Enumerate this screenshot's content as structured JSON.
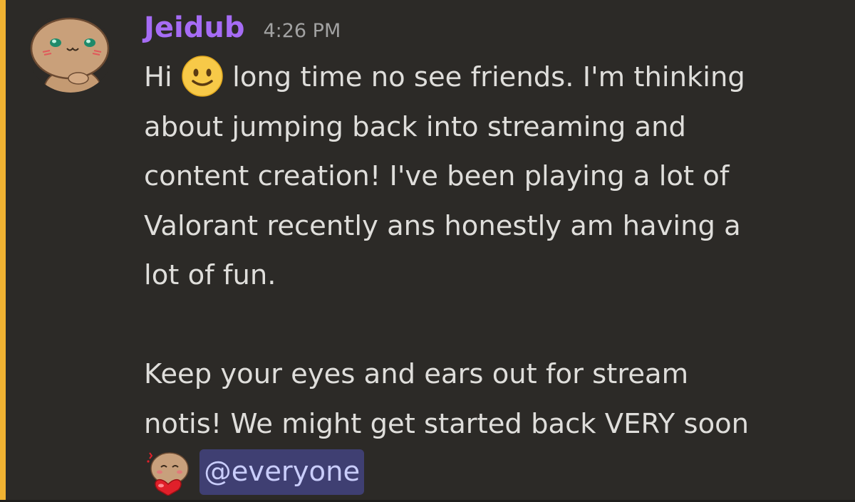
{
  "message": {
    "author": {
      "username": "Jeidub",
      "username_color": "#a66cf5",
      "avatar_icon": "cartoon-bun-avatar"
    },
    "timestamp": "4:26 PM",
    "mention_highlight_color": "#f0b232",
    "content": {
      "line1_before_emoji": "Hi",
      "line1_emoji": "slightly-smiling-face-emoji",
      "line1_after_emoji": "long time no see friends. I'm thinking",
      "line2": "about jumping back into streaming and",
      "line3": "content creation! I've been playing a lot of",
      "line4": "Valorant recently ans honestly am having a",
      "line5": "lot of fun.",
      "line7": "Keep your eyes and ears out for stream",
      "line8": "notis! We might get started back VERY soon",
      "line9_emoji": "blushing-heart-bun-emoji",
      "mention": "@everyone"
    }
  }
}
